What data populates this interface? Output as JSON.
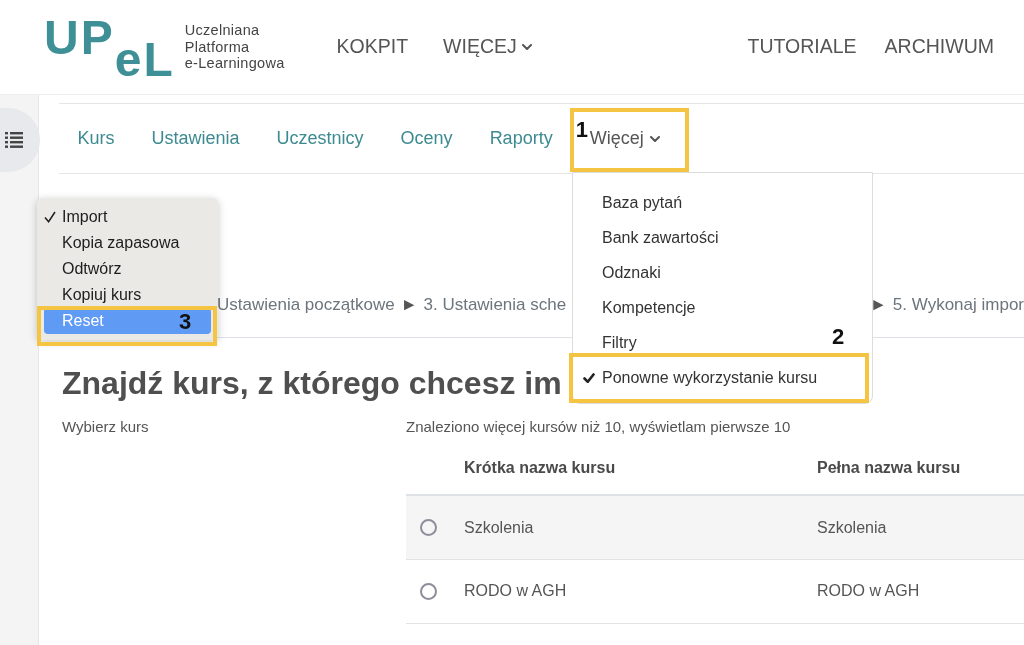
{
  "header": {
    "logo": {
      "mark": "UPeL",
      "tagline": [
        "Uczelniana",
        "Platforma",
        "e-Learningowa"
      ]
    },
    "nav": [
      {
        "label": "KOKPIT",
        "kind": "link"
      },
      {
        "label": "WIĘCEJ",
        "kind": "menu"
      },
      {
        "label": "TUTORIALE",
        "kind": "link"
      },
      {
        "label": "ARCHIWUM",
        "kind": "link"
      }
    ]
  },
  "course_nav": {
    "tabs": [
      {
        "label": "Kurs",
        "kind": "link",
        "selected": false
      },
      {
        "label": "Ustawienia",
        "kind": "link",
        "selected": false
      },
      {
        "label": "Uczestnicy",
        "kind": "link",
        "selected": false
      },
      {
        "label": "Oceny",
        "kind": "link",
        "selected": false
      },
      {
        "label": "Raporty",
        "kind": "link",
        "selected": false
      },
      {
        "label": "Więcej",
        "kind": "menu",
        "selected": true,
        "annotation": "1"
      }
    ]
  },
  "more_menu": {
    "items": [
      {
        "label": "Baza pytań",
        "checked": false
      },
      {
        "label": "Bank zawartości",
        "checked": false
      },
      {
        "label": "Odznaki",
        "checked": false
      },
      {
        "label": "Kompetencje",
        "checked": false
      },
      {
        "label": "Filtry",
        "checked": false
      },
      {
        "label": "Ponowne wykorzystanie kursu",
        "checked": true,
        "annotation": "2"
      }
    ]
  },
  "action_menu": {
    "items": [
      {
        "label": "Import",
        "checked": true,
        "highlighted": false
      },
      {
        "label": "Kopia zapasowa",
        "checked": false,
        "highlighted": false
      },
      {
        "label": "Odtwórz",
        "checked": false,
        "highlighted": false
      },
      {
        "label": "Kopiuj kurs",
        "checked": false,
        "highlighted": false
      },
      {
        "label": "Reset",
        "checked": false,
        "highlighted": true,
        "annotation": "3"
      }
    ]
  },
  "steps": {
    "start": [
      {
        "kind": "step",
        "text": "Ustawienia początkowe"
      },
      {
        "kind": "separator",
        "text": "►"
      },
      {
        "kind": "step",
        "text": "3. Ustawienia sche"
      }
    ],
    "end": [
      {
        "kind": "separator",
        "text": "►"
      },
      {
        "kind": "step",
        "text": "5. Wykonaj impor"
      }
    ]
  },
  "page": {
    "heading": "Znajdź kurs, z którego chcesz im",
    "field_label": "Wybierz kurs",
    "result_note": "Znaleziono więcej kursów niż 10, wyświetlam pierwsze 10"
  },
  "table": {
    "columns": [
      "Krótka nazwa kursu",
      "Pełna nazwa kursu"
    ],
    "rows": [
      {
        "cells": [
          "Szkolenia",
          "Szkolenia"
        ],
        "selected": false
      },
      {
        "cells": [
          "RODO w AGH",
          "RODO w AGH"
        ],
        "selected": false
      }
    ]
  }
}
